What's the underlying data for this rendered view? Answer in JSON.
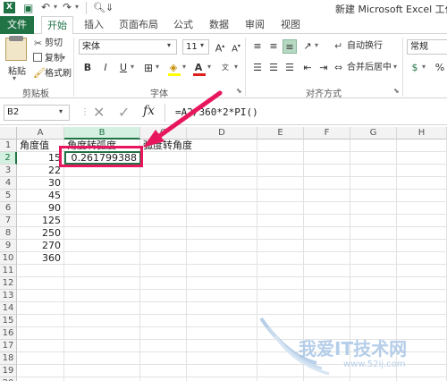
{
  "window": {
    "title": "新建 Microsoft Excel 工作表"
  },
  "colors": {
    "excel_green": "#217346",
    "arrow_red": "#e8175d",
    "highlight_box": "#e8175d",
    "active_col_hdr": "#d3f0e0"
  },
  "ribbon_tabs": [
    "文件",
    "开始",
    "插入",
    "页面布局",
    "公式",
    "数据",
    "审阅",
    "视图"
  ],
  "clipboard": {
    "paste": "粘贴",
    "cut": "剪切",
    "copy": "复制",
    "format_painter": "格式刷",
    "group": "剪贴板"
  },
  "font": {
    "name": "宋体",
    "size": "11",
    "bold": "B",
    "italic": "I",
    "underline": "U",
    "group": "字体"
  },
  "alignment": {
    "wrap": "自动换行",
    "merge": "合并后居中",
    "group": "对齐方式"
  },
  "number": {
    "format": "常规",
    "percent": "%"
  },
  "formula_bar": {
    "name_box": "B2",
    "fx": "fx",
    "formula": "=A2/360*2*PI()"
  },
  "sheet": {
    "columns": [
      "A",
      "B",
      "C",
      "D",
      "E",
      "F",
      "G",
      "H"
    ],
    "rows": [
      "1",
      "2",
      "3",
      "4",
      "5",
      "6",
      "7",
      "8",
      "9",
      "10",
      "11",
      "12",
      "13",
      "14",
      "15",
      "16",
      "17",
      "18",
      "19",
      "20"
    ],
    "headers": {
      "a1": "角度值",
      "b1": "角度转弧度",
      "c1": "弧度转角度"
    },
    "angles": [
      "15",
      "22",
      "30",
      "45",
      "90",
      "125",
      "250",
      "270",
      "360"
    ],
    "b2": "0.261799388"
  },
  "watermark": {
    "text": "我爱IT技术网",
    "url": "www.52ij.com"
  }
}
